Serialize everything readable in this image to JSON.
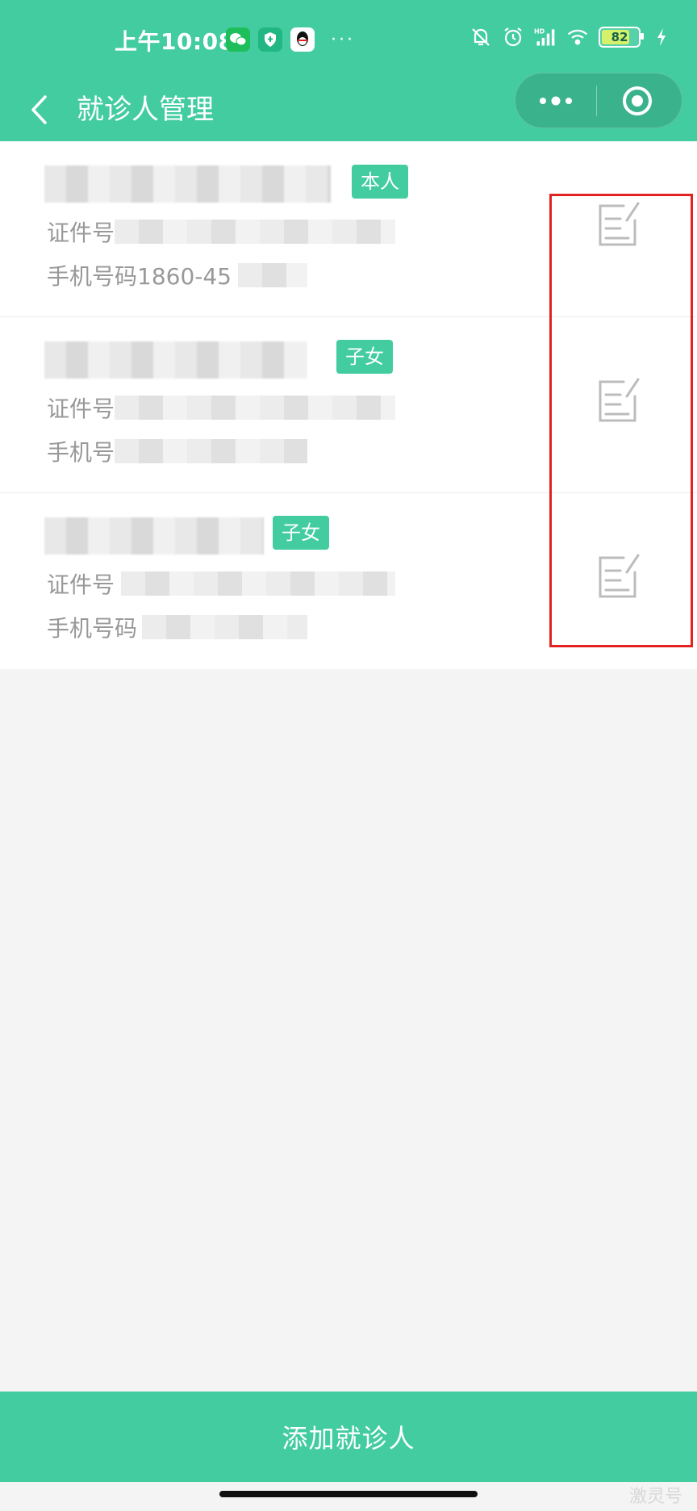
{
  "status_bar": {
    "time": "上午10:08",
    "app_icons": [
      "wechat-icon",
      "shield-icon",
      "qq-icon"
    ],
    "more": "···",
    "system_icons": [
      "mute-icon",
      "alarm-icon",
      "signal-icon",
      "wifi-icon"
    ],
    "battery": "82",
    "network_label": "HD"
  },
  "nav": {
    "title": "就诊人管理",
    "back_icon": "chevron-left-icon",
    "capsule": {
      "more_icon": "more-dots-icon",
      "close_icon": "target-circle-icon"
    }
  },
  "patients": [
    {
      "tag": "本人",
      "id_label": "证件号",
      "phone_label": "手机号码1860-45"
    },
    {
      "tag": "子女",
      "id_label": "证件号",
      "phone_label": "手机号"
    },
    {
      "tag": "子女",
      "id_label": "证件号",
      "phone_label": "手机号码"
    }
  ],
  "footer": {
    "add_button": "添加就诊人"
  },
  "watermark": "激灵号",
  "colors": {
    "brand": "#43cca0",
    "highlight": "#e32222",
    "background": "#f4f4f4"
  }
}
